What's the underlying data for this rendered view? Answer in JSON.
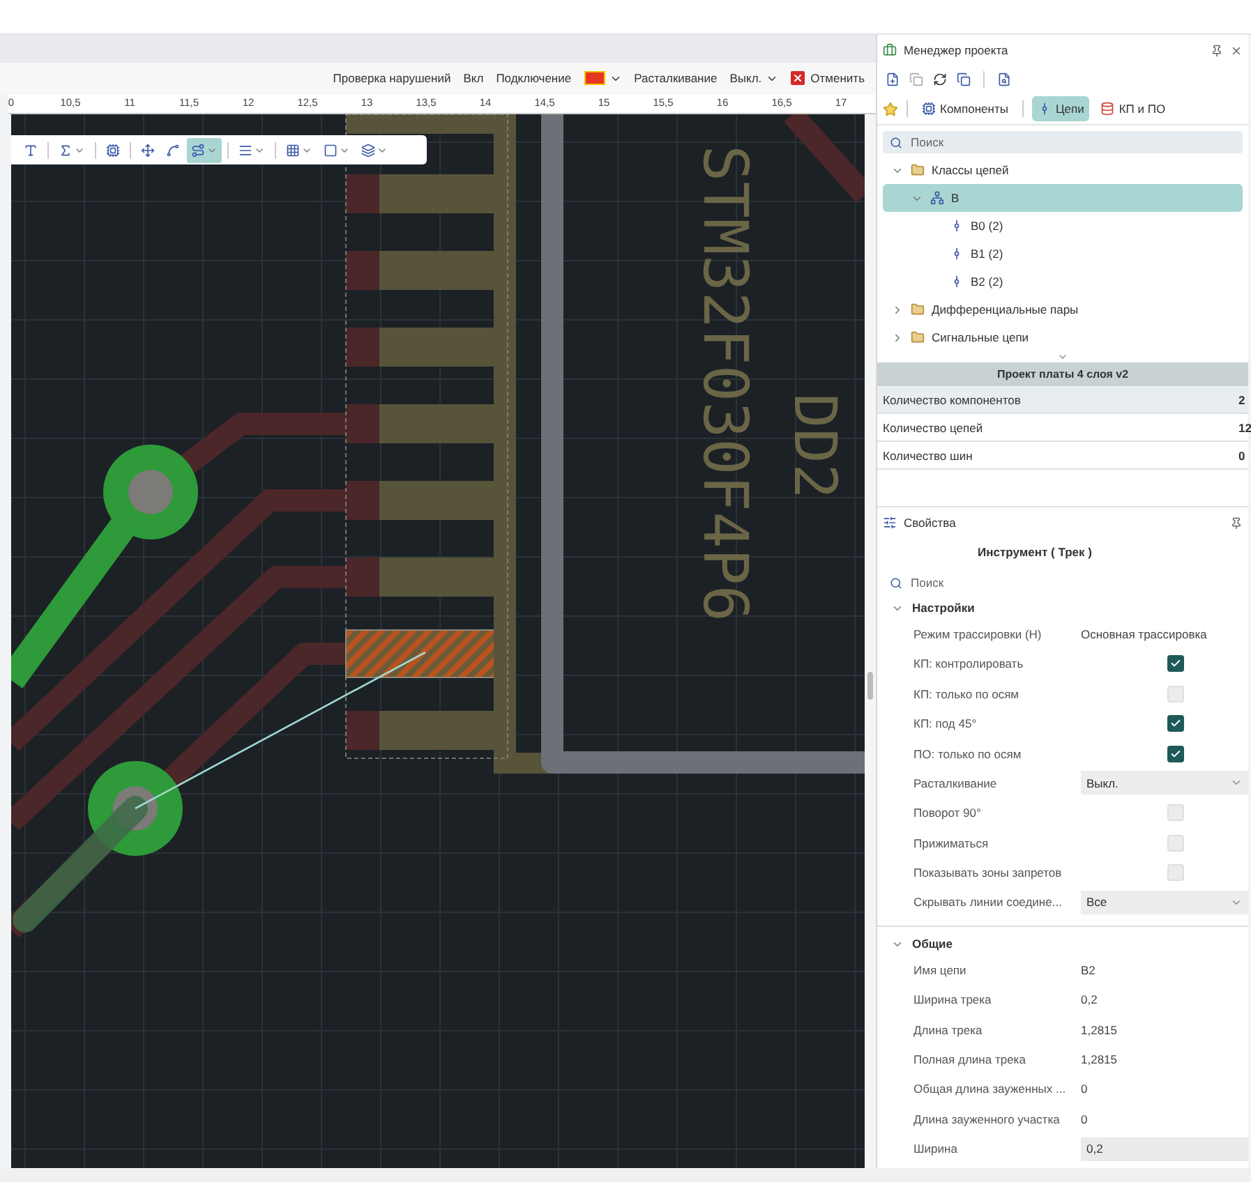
{
  "toolbar": {
    "items": [
      {
        "kind": "label",
        "text": "Проверка нарушений"
      },
      {
        "kind": "label",
        "text": "Вкл"
      },
      {
        "kind": "label",
        "text": "Подключение"
      },
      {
        "kind": "color",
        "color": "#e8371f"
      },
      {
        "kind": "label",
        "text": "Расталкивание"
      },
      {
        "kind": "dropdown",
        "text": "Выкл."
      },
      {
        "kind": "cancel",
        "text": "Отменить"
      }
    ]
  },
  "ruler": {
    "ticks": [
      "0",
      "10,5",
      "11",
      "11,5",
      "12",
      "12,5",
      "13",
      "13,5",
      "14",
      "14,5",
      "15",
      "15,5",
      "16",
      "16,5",
      "17"
    ]
  },
  "canvas_tools": [
    {
      "selected": false
    },
    {
      "selected": false
    },
    {
      "selected": false
    },
    {
      "selected": false
    },
    {
      "selected": false
    },
    {
      "selected": true
    },
    {
      "selected": false
    },
    {
      "selected": false
    },
    {
      "selected": false
    },
    {
      "selected": false
    }
  ],
  "canvas": {
    "labels": [
      {
        "text": "DD2"
      },
      {
        "text": "STM32F030F4P6"
      }
    ]
  },
  "project_manager": {
    "title": "Менеджер проекта",
    "tabs": [
      {
        "label": "Компоненты",
        "selected": false
      },
      {
        "label": "Цепи",
        "selected": true
      },
      {
        "label": "КП и ПО",
        "selected": false
      }
    ],
    "search": {
      "placeholder": "Поиск"
    },
    "tree": [
      {
        "label": "Классы цепей",
        "kind": "folder",
        "expanded": true,
        "selected": false,
        "children": [
          {
            "label": "B",
            "kind": "class",
            "expanded": true,
            "selected": true,
            "children": [
              {
                "label": "B0 (2)",
                "kind": "net",
                "selected": false
              },
              {
                "label": "B1 (2)",
                "kind": "net",
                "selected": false
              },
              {
                "label": "B2 (2)",
                "kind": "net",
                "selected": false
              }
            ]
          }
        ]
      },
      {
        "label": "Дифференциальные пары",
        "kind": "folder",
        "expanded": false,
        "selected": false
      },
      {
        "label": "Сигнальные цепи",
        "kind": "folder",
        "expanded": false,
        "selected": false
      }
    ]
  },
  "board_summary": {
    "title": "Проект платы 4 слоя v2",
    "rows": [
      {
        "label": "Количество компонентов",
        "value": "2"
      },
      {
        "label": "Количество цепей",
        "value": "12"
      },
      {
        "label": "Количество шин",
        "value": "0"
      }
    ]
  },
  "properties": {
    "title": "Свойства",
    "tool": "Инструмент ( Трек )",
    "search": {
      "placeholder": "Поиск"
    },
    "sections": [
      {
        "title": "Настройки",
        "expanded": true,
        "rows": [
          {
            "kind": "text",
            "label": "Режим трассировки (H)",
            "value": "Основная трассировка"
          },
          {
            "kind": "check",
            "label": "КП: контролировать",
            "checked": true
          },
          {
            "kind": "check",
            "label": "КП: только по осям",
            "checked": false
          },
          {
            "kind": "check",
            "label": "КП: под 45°",
            "checked": true
          },
          {
            "kind": "check",
            "label": "ПО: только по осям",
            "checked": true
          },
          {
            "kind": "select",
            "label": "Расталкивание",
            "value": "Выкл."
          },
          {
            "kind": "check",
            "label": "Поворот 90°",
            "checked": false
          },
          {
            "kind": "check",
            "label": "Прижиматься",
            "checked": false
          },
          {
            "kind": "check",
            "label": "Показывать зоны запретов",
            "checked": false
          },
          {
            "kind": "select",
            "label": "Скрывать линии соедине...",
            "value": "Все"
          }
        ]
      },
      {
        "title": "Общие",
        "expanded": true,
        "rows": [
          {
            "kind": "text",
            "label": "Имя цепи",
            "value": "B2"
          },
          {
            "kind": "text",
            "label": "Ширина трека",
            "value": "0,2"
          },
          {
            "kind": "text",
            "label": "Длина трека",
            "value": "1,2815"
          },
          {
            "kind": "text",
            "label": "Полная длина трека",
            "value": "1,2815"
          },
          {
            "kind": "text",
            "label": "Общая длина зауженных ...",
            "value": "0"
          },
          {
            "kind": "text",
            "label": "Длина зауженного участка",
            "value": "0"
          },
          {
            "kind": "field",
            "label": "Ширина",
            "value": "0,2"
          }
        ]
      }
    ]
  }
}
